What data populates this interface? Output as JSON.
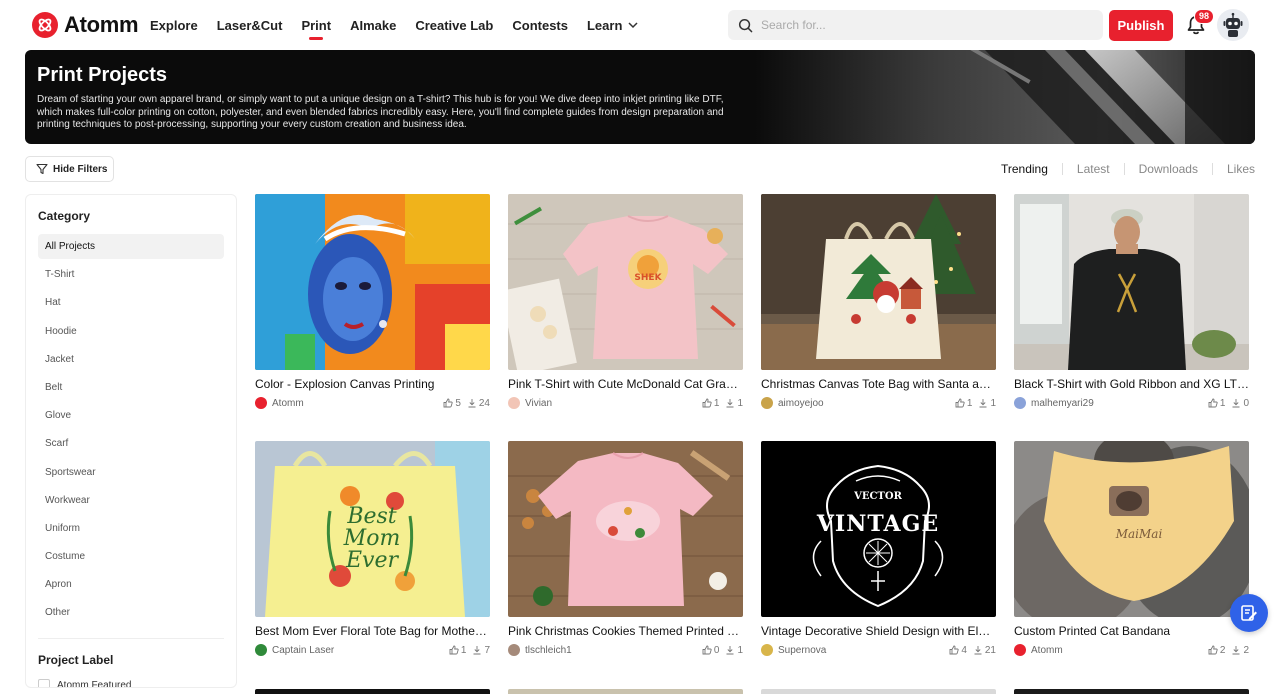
{
  "brand": {
    "name": "Atomm",
    "color": "#e8212e"
  },
  "nav": {
    "items": [
      "Explore",
      "Laser&Cut",
      "Print",
      "AImake",
      "Creative Lab",
      "Contests",
      "Learn"
    ],
    "active": "Print"
  },
  "search": {
    "placeholder": "Search for..."
  },
  "header": {
    "publish_label": "Publish",
    "notification_count": "98"
  },
  "banner": {
    "title": "Print Projects",
    "description": "Dream of starting your own apparel brand, or simply want to put a unique design on a T-shirt? This hub is for you! We dive deep into inkjet printing like DTF, which makes full-color printing on cotton, polyester, and even blended fabrics incredibly easy. Here, you'll find complete guides from design preparation and printing techniques to post-processing, supporting your every custom creation and business idea."
  },
  "filters": {
    "hide_label": "Hide Filters"
  },
  "sort": {
    "options": [
      "Trending",
      "Latest",
      "Downloads",
      "Likes"
    ],
    "selected": "Trending"
  },
  "sidebar": {
    "category_heading": "Category",
    "categories": [
      "All Projects",
      "T-Shirt",
      "Hat",
      "Hoodie",
      "Jacket",
      "Belt",
      "Glove",
      "Scarf",
      "Sportswear",
      "Workwear",
      "Uniform",
      "Costume",
      "Apron",
      "Other"
    ],
    "selected": "All Projects",
    "label_heading": "Project Label",
    "label_option": "Atomm Featured"
  },
  "projects": [
    {
      "title": "Color - Explosion Canvas Printing",
      "author": "Atomm",
      "likes": "5",
      "downloads": "24"
    },
    {
      "title": "Pink T-Shirt with Cute McDonald Cat Graphic Print",
      "author": "Vivian",
      "likes": "1",
      "downloads": "1"
    },
    {
      "title": "Christmas Canvas Tote Bag with Santa and Gingerbread House",
      "author": "aimoyejoo",
      "likes": "1",
      "downloads": "1"
    },
    {
      "title": "Black T-Shirt with Gold Ribbon and XG LTD Print",
      "author": "malhemyari29",
      "likes": "1",
      "downloads": "0"
    },
    {
      "title": "Best Mom Ever Floral Tote Bag for Mother's Day",
      "author": "Captain Laser",
      "likes": "1",
      "downloads": "7"
    },
    {
      "title": "Pink Christmas Cookies Themed Printed T-Shirt",
      "author": "tlschleich1",
      "likes": "0",
      "downloads": "1"
    },
    {
      "title": "Vintage Decorative Shield Design with Elegant Ornaments",
      "author": "Supernova",
      "likes": "4",
      "downloads": "21"
    },
    {
      "title": "Custom Printed Cat Bandana",
      "author": "Atomm",
      "likes": "2",
      "downloads": "2"
    }
  ],
  "artwork_text": {
    "vintage_top": "VECTOR",
    "vintage_main": "VINTAGE",
    "bandana_text": "MaiMai",
    "tote_text": [
      "Best",
      "Mom",
      "Ever"
    ],
    "tee_text": "SHEK"
  }
}
